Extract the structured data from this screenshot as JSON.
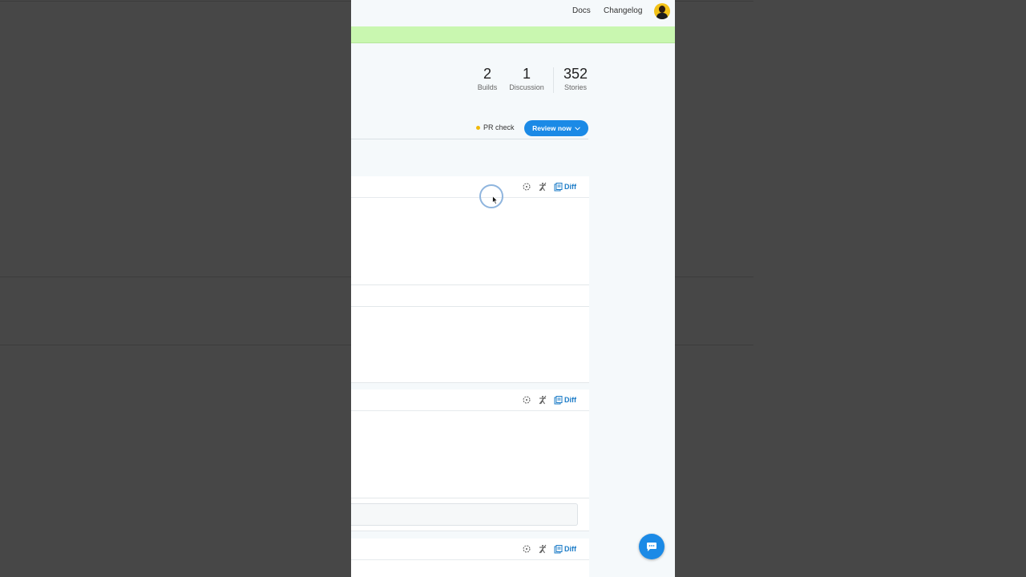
{
  "nav": {
    "docs": "Docs",
    "changelog": "Changelog"
  },
  "stats": [
    {
      "value": "2",
      "label": "Builds"
    },
    {
      "value": "1",
      "label": "Discussion"
    },
    {
      "value": "352",
      "label": "Stories"
    }
  ],
  "toolbar": {
    "pr_check": "PR check",
    "review_button": "Review now"
  },
  "cards": [
    {
      "diff_label": "Diff"
    },
    {
      "diff_label": "Diff"
    },
    {
      "diff_label": "Diff"
    }
  ],
  "colors": {
    "accent": "#1b8ae6",
    "banner": "#c9f7b0",
    "pr_dot": "#f0b90b"
  }
}
